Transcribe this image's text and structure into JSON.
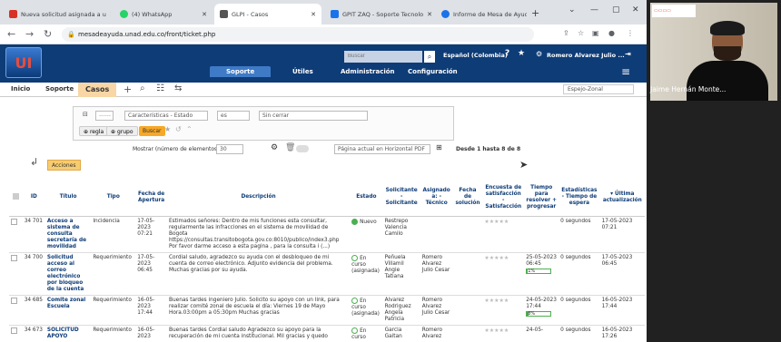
{
  "browser": {
    "tabs": [
      {
        "label": "Nueva solicitud asignada a u",
        "color": "#d93025",
        "active": false
      },
      {
        "label": "(4) WhatsApp",
        "color": "#25d366",
        "active": false
      },
      {
        "label": "GLPI - Casos",
        "color": "#555555",
        "active": true
      },
      {
        "label": "GPIT ZAQ - Soporte Tecnolo",
        "color": "#1a73e8",
        "active": false
      },
      {
        "label": "Informe de Mesa de Ayuda -",
        "color": "#1a73e8",
        "active": false
      }
    ],
    "url": "mesadeayuda.unad.edu.co/front/ticket.php"
  },
  "header": {
    "logo_text": "UI",
    "search_placeholder": "Buscar",
    "language": "Español (Colombia)",
    "help_icon": "?",
    "user": "Romero Alvarez Julio ...",
    "menu": [
      "Soporte",
      "Útiles",
      "Administración",
      "Configuración"
    ]
  },
  "breadcrumb": {
    "home": "Inicio",
    "support": "Soporte",
    "cases": "Casos",
    "entity_select": "Espejo-Zonal"
  },
  "filter": {
    "field": "Características - Estado",
    "operator": "es",
    "value": "Sin cerrar",
    "rule_label": "regla",
    "group_label": "grupo",
    "search_label": "Buscar",
    "dash_option": "------"
  },
  "pager": {
    "show_label": "Mostrar (número de elementos)",
    "show_value": "30",
    "export_label": "Página actual en Horizontal PDF",
    "range_text": "Desde 1 hasta 8 de 8"
  },
  "actions_label": "Acciones",
  "table": {
    "columns": [
      "ID",
      "Título",
      "Tipo",
      "Fecha de Apertura",
      "Descripción",
      "Estado",
      "Solicitante - Solicitante",
      "Asignado a: - Técnico",
      "Fecha de solución",
      "Encuesta de satisfacción - Satisfacción",
      "Tiempo para resolver + progresar",
      "Estadísticas - Tiempo de espera",
      "▾ Última actualización"
    ],
    "rows": [
      {
        "id": "34 701",
        "title": "Acceso a sistema de consulta secretaría de movilidad",
        "type": "Incidencia",
        "opened": "17-05-2023 07:21",
        "description": "Estimados señores: Dentro de mis funciones esta consultar, regularmente las infracciones en el sistema de movilidad de Bogota https://consultas.transitobogota.gov.co:8010/publico/index3.php Por favor darme acceso a esta pagina , para la consulta i (...)",
        "status": "Nuevo",
        "status_color": "#4caf50",
        "requester": "Restrepo Valencia Camilo",
        "technician": "",
        "solution_date": "",
        "time_to_resolve": "",
        "progress": "",
        "wait": "0 segundos",
        "updated": "17-05-2023 07:21"
      },
      {
        "id": "34 700",
        "title": "Solicitud acceso al correo electrónico por bloqueo de la cuenta",
        "type": "Requerimiento",
        "opened": "17-05-2023 06:45",
        "description": "Cordial saludo, agradezco su ayuda con el desbloqueo de mi cuenta de correo electrónico. Adjunto evidencia del problema. Muchas gracias por su ayuda.",
        "status": "En curso (asignada)",
        "status_color": "#4caf50",
        "requester": "Peñuela Villamil Angie Tatiana",
        "technician": "Romero Alvarez Julio Cesar",
        "solution_date": "",
        "time_to_resolve": "25-05-2023 06:45",
        "progress": "1%",
        "progress_value": 0.01,
        "wait": "0 segundos",
        "updated": "17-05-2023 06:45"
      },
      {
        "id": "34 685",
        "title": "Comite zonal Escuela",
        "type": "Requerimiento",
        "opened": "16-05-2023 17:44",
        "description": "Buenas tardes ingeniero Julio. Solicito su apoyo con un link, para realizar comité zonal de escuela el día: Viernes 19 de Mayo Hora.03:00pm a 05:30pm Muchas gracias",
        "status": "En curso (asignada)",
        "status_color": "#4caf50",
        "requester": "Alvarez Rodriguez Angela Patricia",
        "technician": "Romero Alvarez Julio Cesar",
        "solution_date": "",
        "time_to_resolve": "24-05-2023 17:44",
        "progress": "8%",
        "progress_value": 0.08,
        "wait": "0 segundos",
        "updated": "16-05-2023 17:44"
      },
      {
        "id": "34 673",
        "title": "SOLICITUD APOYO",
        "type": "Requerimiento",
        "opened": "16-05-2023",
        "description": "Buenas tardes Cordial saludo Agradezco su apoyo para la recuperación de mi cuenta institucional. Mil gracias y quedo",
        "status": "En curso",
        "status_color": "#4caf50",
        "requester": "Garcia Gaitan",
        "technician": "Romero Alvarez",
        "solution_date": "",
        "time_to_resolve": "24-05-",
        "progress": "",
        "wait": "0 segundos",
        "updated": "16-05-2023 17:26"
      }
    ]
  },
  "video": {
    "participant_name": "Jaime Hernán Monte..."
  }
}
